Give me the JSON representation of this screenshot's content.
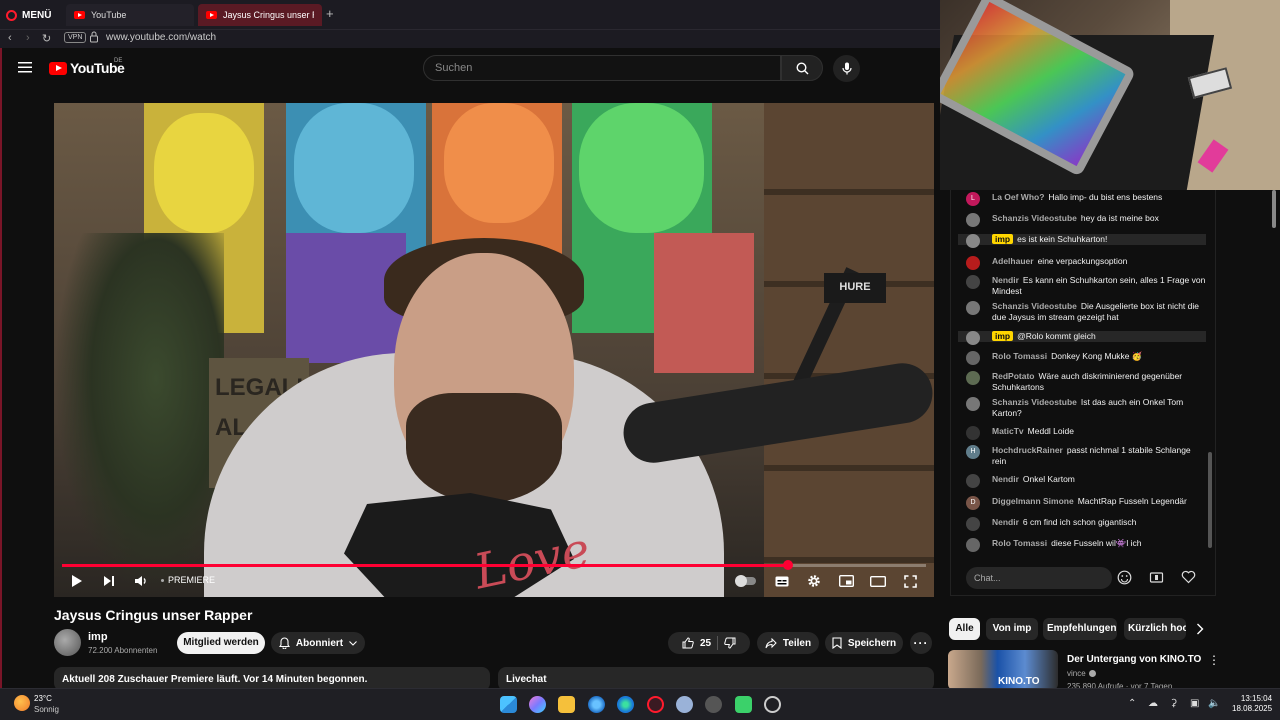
{
  "browser": {
    "menu_label": "MENÜ",
    "tabs": [
      {
        "label": "YouTube"
      },
      {
        "label": "Jaysus Cringus unser Rap"
      }
    ],
    "vpn_label": "VPN",
    "url": "www.youtube.com/watch"
  },
  "youtube": {
    "logo_text": "YouTube",
    "region": "DE",
    "search_placeholder": "Suchen"
  },
  "player": {
    "premiere_label": "PREMIERE",
    "progress": 0.84,
    "overlay_text": {
      "sign": "LEGALIS\nAL",
      "mic_brand": "HURE",
      "shirt": "Love"
    }
  },
  "video": {
    "title": "Jaysus Cringus unser Rapper",
    "channel_name": "imp",
    "subscribers": "72.200 Abonnenten",
    "member_label": "Mitglied werden",
    "subscribed_label": "Abonniert",
    "likes": "25",
    "share_label": "Teilen",
    "save_label": "Speichern",
    "more_label": "···",
    "info_text": "Aktuell 208 Zuschauer  Premiere läuft. Vor 14 Minuten begonnen.",
    "livechat_label": "Livechat"
  },
  "chat": {
    "messages": [
      {
        "name": "La Oef Who?",
        "text": "Hallo imp- du bist ens bestens",
        "avatar": "#c2185b",
        "avatar_letter": "L",
        "own": false
      },
      {
        "name": "Schanzis Videostube",
        "text": "hey da ist meine box",
        "avatar": "#777",
        "avatar_letter": "",
        "own": false
      },
      {
        "name": "imp",
        "text": "es ist kein Schuhkarton!",
        "avatar": "#888",
        "avatar_letter": "",
        "own": true
      },
      {
        "name": "Adelhauer",
        "text": "eine verpackungsoption",
        "avatar": "#b71c1c",
        "avatar_letter": "",
        "own": false
      },
      {
        "name": "Nendir",
        "text": "Es kann ein Schuhkarton sein, alles 1 Frage von Mindest",
        "avatar": "#444",
        "avatar_letter": "",
        "own": false
      },
      {
        "name": "Schanzis Videostube",
        "text": "Die Ausgelierte box ist nicht die due Jaysus im stream gezeigt hat",
        "avatar": "#777",
        "avatar_letter": "",
        "own": false
      },
      {
        "name": "imp",
        "text": "@Rolo kommt gleich",
        "avatar": "#888",
        "avatar_letter": "",
        "own": true
      },
      {
        "name": "Rolo Tomassi",
        "text": "Donkey Kong Mukke 🥳",
        "avatar": "#666",
        "avatar_letter": "",
        "own": false
      },
      {
        "name": "RedPotato",
        "text": "Wäre auch diskriminierend gegenüber Schuhkartons",
        "avatar": "#5d6b52",
        "avatar_letter": "",
        "own": false
      },
      {
        "name": "Schanzis Videostube",
        "text": "Ist das auch ein Onkel Tom Karton?",
        "avatar": "#777",
        "avatar_letter": "",
        "own": false
      },
      {
        "name": "MaticTv",
        "text": "Meddl Loide",
        "avatar": "#333",
        "avatar_letter": "",
        "own": false
      },
      {
        "name": "HochdruckRainer",
        "text": "passt nichmal 1 stabile Schlange rein",
        "avatar": "#607d8b",
        "avatar_letter": "H",
        "own": false
      },
      {
        "name": "Nendir",
        "text": "Onkel Kartom",
        "avatar": "#444",
        "avatar_letter": "",
        "own": false
      },
      {
        "name": "Diggelmann Simone",
        "text": "MachtRap Fusseln Legendär",
        "avatar": "#795548",
        "avatar_letter": "D",
        "own": false
      },
      {
        "name": "Nendir",
        "text": "6 cm find ich schon gigantisch",
        "avatar": "#444",
        "avatar_letter": "",
        "own": false
      },
      {
        "name": "Rolo Tomassi",
        "text": "diese Fusseln wil👾l ich",
        "avatar": "#666",
        "avatar_letter": "",
        "own": false
      }
    ],
    "input_placeholder": "Chat..."
  },
  "recommendations": {
    "chips": [
      "Alle",
      "Von imp",
      "Empfehlungen",
      "Kürzlich hoc"
    ],
    "first": {
      "title": "Der Untergang von KINO.TO",
      "channel": "vince",
      "meta": "235.890 Aufrufe · vor 7 Tagen",
      "thumb_text": "KINO.TO"
    }
  },
  "taskbar": {
    "temperature": "23°C",
    "weather": "Sonnig",
    "time": "13:15:04",
    "date": "18.08.2025"
  },
  "colors": {
    "accent": "#ff0033",
    "youtube_red": "#ff0000",
    "owner_badge": "#ffd600",
    "chip_active": "#f1f1f1"
  }
}
